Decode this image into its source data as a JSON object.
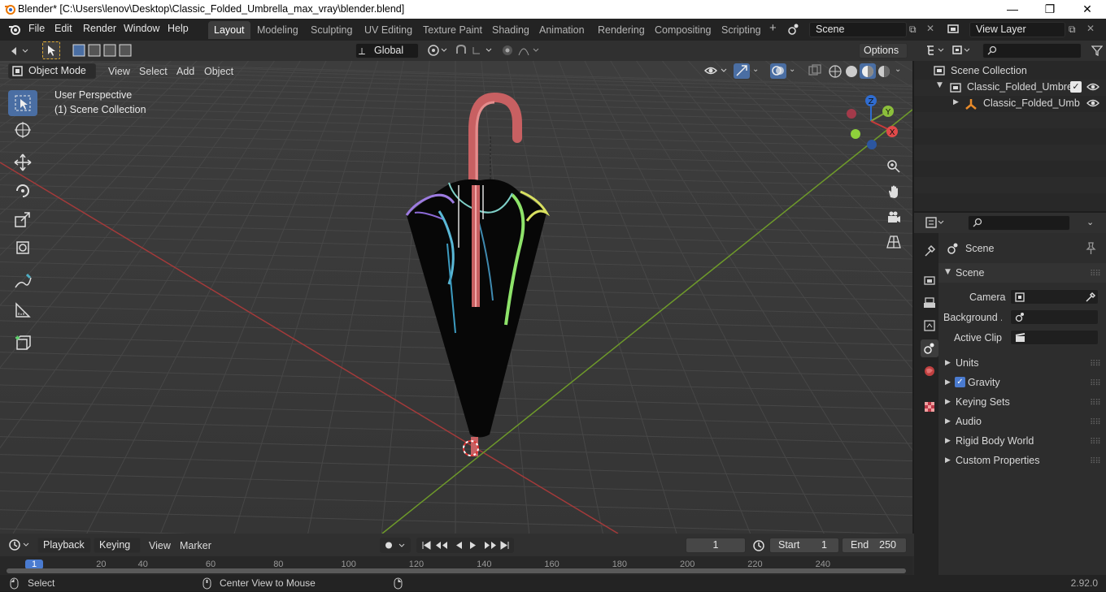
{
  "window": {
    "title": "Blender* [C:\\Users\\lenov\\Desktop\\Classic_Folded_Umbrella_max_vray\\blender.blend]",
    "minimize": "—",
    "maximize": "❐",
    "close": "✕"
  },
  "menubar": {
    "items": [
      "File",
      "Edit",
      "Render",
      "Window",
      "Help"
    ]
  },
  "workspaces": {
    "tabs": [
      "Layout",
      "Modeling",
      "Sculpting",
      "UV Editing",
      "Texture Paint",
      "Shading",
      "Animation",
      "Rendering",
      "Compositing",
      "Scripting"
    ],
    "active": "Layout",
    "add": "+"
  },
  "scene_selector": {
    "value": "Scene"
  },
  "view_layer_selector": {
    "value": "View Layer"
  },
  "viewport_header": {
    "mode": "Object Mode",
    "menus": [
      "View",
      "Select",
      "Add",
      "Object"
    ],
    "transform_orientation": "Global",
    "options": "Options"
  },
  "viewport": {
    "perspective_label": "User Perspective",
    "collection_label": "(1) Scene Collection",
    "gizmo": {
      "x": "X",
      "y": "Y",
      "z": "Z"
    },
    "colors": {
      "background": "#393939",
      "grid": "#464646",
      "x_axis": "#a33a3a",
      "y_axis": "#6e9a2a"
    }
  },
  "outliner": {
    "root": "Scene Collection",
    "items": [
      {
        "label": "Classic_Folded_Umbrella",
        "visible": true,
        "checked": true
      },
      {
        "label": "Classic_Folded_Umb",
        "visible": true
      }
    ]
  },
  "properties": {
    "context": "Scene",
    "panel_title": "Scene",
    "fields": [
      {
        "label": "Camera",
        "value": ""
      },
      {
        "label": "Background ...",
        "value": ""
      },
      {
        "label": "Active Clip",
        "value": ""
      }
    ],
    "sections": [
      {
        "label": "Units",
        "checkbox": false
      },
      {
        "label": "Gravity",
        "checkbox": true
      },
      {
        "label": "Keying Sets",
        "checkbox": false
      },
      {
        "label": "Audio",
        "checkbox": false
      },
      {
        "label": "Rigid Body World",
        "checkbox": false
      },
      {
        "label": "Custom Properties",
        "checkbox": false
      }
    ]
  },
  "timeline": {
    "menus": [
      "Playback",
      "Keying",
      "View",
      "Marker"
    ],
    "current_frame": "1",
    "start_label": "Start",
    "start": "1",
    "end_label": "End",
    "end": "250",
    "ruler": [
      "1",
      "20",
      "40",
      "60",
      "80",
      "100",
      "120",
      "140",
      "160",
      "180",
      "200",
      "220",
      "240"
    ]
  },
  "statusbar": {
    "left": "Select",
    "middle": "Center View to Mouse",
    "version": "2.92.0"
  }
}
